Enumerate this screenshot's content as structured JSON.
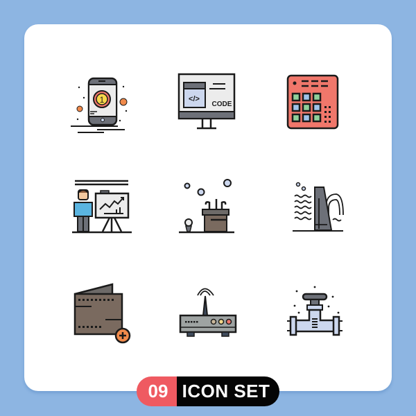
{
  "badge": {
    "number": "09",
    "label": "ICON SET"
  },
  "colors": {
    "background": "#8db5e2",
    "card": "#ffffff",
    "badge_number_bg": "#ef5a61",
    "badge_label_bg": "#050505",
    "stroke": "#1a1a1a",
    "red": "#f0776b",
    "orange": "#f08a4b",
    "yellow": "#f9d74a",
    "blue": "#9fc3ea",
    "green": "#8fd19a",
    "gray": "#6d7078",
    "brown": "#7a6a5f"
  },
  "icons": [
    {
      "name": "mobile-coin-icon",
      "description": "Mobile phone with coin number 1"
    },
    {
      "name": "code-monitor-icon",
      "description": "Monitor showing code window",
      "text": "CODE"
    },
    {
      "name": "drum-pad-icon",
      "description": "Music drum pad / sampler"
    },
    {
      "name": "presentation-icon",
      "description": "Person presenting chart on board"
    },
    {
      "name": "golf-bag-icon",
      "description": "Golf bag with clubs and ball"
    },
    {
      "name": "dam-icon",
      "description": "Dam with water waves"
    },
    {
      "name": "wallet-add-icon",
      "description": "Wallet with plus sign"
    },
    {
      "name": "router-icon",
      "description": "Wireless router"
    },
    {
      "name": "pipe-valve-icon",
      "description": "Pipe valve"
    }
  ]
}
